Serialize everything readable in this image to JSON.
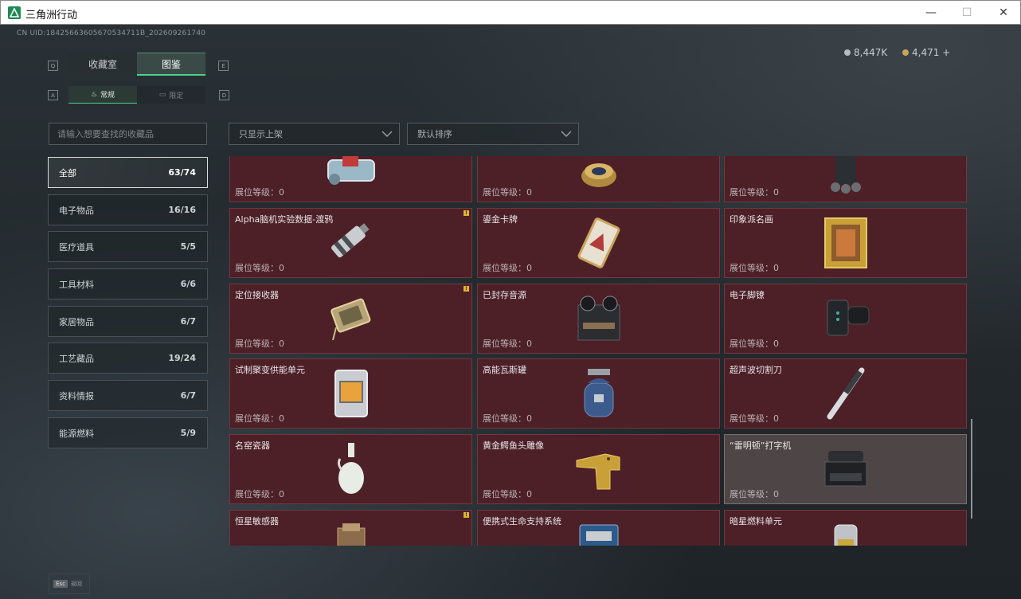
{
  "window": {
    "title": "三角洲行动",
    "minimize": "—",
    "maximize": "☐",
    "close": "✕"
  },
  "uid": "CN UID:18425663605670534711B_202609261740",
  "currency": [
    {
      "icon": "silver-coin-icon",
      "value": "8,447K",
      "color": "#b7bcc0"
    },
    {
      "icon": "gold-coin-icon",
      "value": "4,471 +",
      "color": "#c9a45c"
    }
  ],
  "key_hints": {
    "tab_prev": "Q",
    "tab_next": "E",
    "sub_prev": "A",
    "sub_next": "D"
  },
  "tabs": [
    {
      "label": "收藏室"
    },
    {
      "label": "图鉴"
    }
  ],
  "subtabs": [
    {
      "label": "常规"
    },
    {
      "label": "限定"
    }
  ],
  "search": {
    "placeholder": "请输入想要查找的收藏品"
  },
  "filters": {
    "shelf": "只显示上架",
    "sort": "默认排序"
  },
  "categories": [
    {
      "label": "全部",
      "count": "63/74"
    },
    {
      "label": "电子物品",
      "count": "16/16"
    },
    {
      "label": "医疗道具",
      "count": "5/5"
    },
    {
      "label": "工具材料",
      "count": "6/6"
    },
    {
      "label": "家居物品",
      "count": "6/7"
    },
    {
      "label": "工艺藏品",
      "count": "19/24"
    },
    {
      "label": "资料情报",
      "count": "6/7"
    },
    {
      "label": "能源燃料",
      "count": "5/9"
    }
  ],
  "level_label": "展位等级：0",
  "warn_mark": "!",
  "items": [
    {
      "name": "",
      "icon": "engine-part-icon"
    },
    {
      "name": "",
      "icon": "caviar-tin-icon"
    },
    {
      "name": "",
      "icon": "backpack-device-icon"
    },
    {
      "name": "Alpha脑机实验数据-渡鸦",
      "icon": "data-drive-icon"
    },
    {
      "name": "鎏金卡牌",
      "icon": "gilded-card-icon"
    },
    {
      "name": "印象派名画",
      "icon": "painting-icon"
    },
    {
      "name": "定位接收器",
      "icon": "receiver-icon"
    },
    {
      "name": "已封存音源",
      "icon": "tape-recorder-icon"
    },
    {
      "name": "电子脚镣",
      "icon": "ankle-monitor-icon"
    },
    {
      "name": "试制聚变供能单元",
      "icon": "fusion-cell-icon"
    },
    {
      "name": "高能瓦斯罐",
      "icon": "gas-tank-icon"
    },
    {
      "name": "超声波切割刀",
      "icon": "ultrasonic-knife-icon"
    },
    {
      "name": "名窑瓷器",
      "icon": "porcelain-vase-icon"
    },
    {
      "name": "黄金鳄鱼头雕像",
      "icon": "gold-crocodile-icon"
    },
    {
      "name": "“雷明顿”打字机",
      "icon": "typewriter-icon"
    },
    {
      "name": "恒星敏感器",
      "icon": "star-sensor-icon"
    },
    {
      "name": "便携式生命支持系统",
      "icon": "life-support-icon"
    },
    {
      "name": "暗星燃料单元",
      "icon": "fuel-cell-icon"
    }
  ],
  "esc": {
    "key": "Esc",
    "label": "返回"
  }
}
